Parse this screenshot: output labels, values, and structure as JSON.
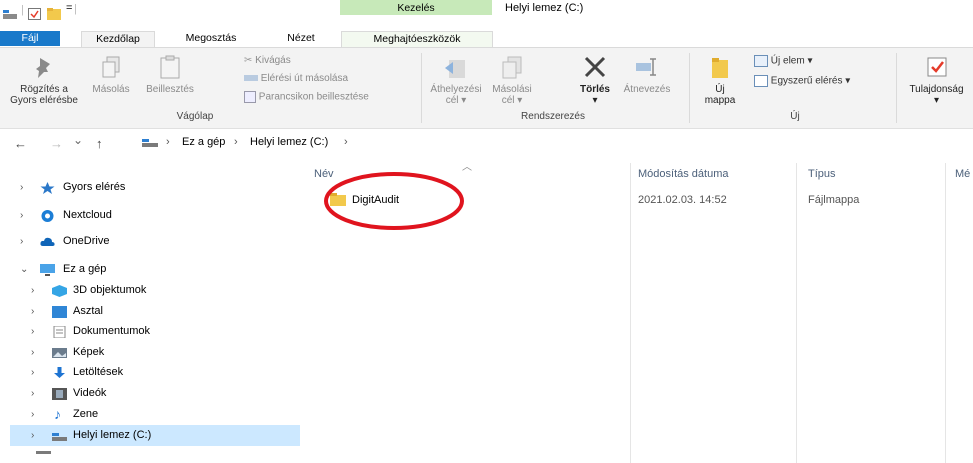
{
  "window": {
    "contextual_tab_group": "Kezelés",
    "title": "Helyi lemez (C:)"
  },
  "ribbon_tabs": [
    "Fájl",
    "Kezdőlap",
    "Megosztás",
    "Nézet",
    "Meghajtóeszközök"
  ],
  "ribbon": {
    "clipboard": {
      "pin_label_1": "Rögzítés a",
      "pin_label_2": "Gyors elérésbe",
      "copy": "Másolás",
      "paste": "Beillesztés",
      "cut": "Kivágás",
      "copy_path": "Elérési út másolása",
      "paste_shortcut": "Parancsikon beillesztése",
      "group": "Vágólap"
    },
    "organize": {
      "move_to_1": "Áthelyezési",
      "move_to_2": "cél ▾",
      "copy_to_1": "Másolási",
      "copy_to_2": "cél ▾",
      "delete": "Törlés",
      "delete_arrow": "▾",
      "rename": "Átnevezés",
      "group": "Rendszerezés"
    },
    "new": {
      "new_folder_1": "Új",
      "new_folder_2": "mappa",
      "new_item": "Új elem ▾",
      "easy_access": "Egyszerű elérés ▾",
      "group": "Új"
    },
    "open": {
      "properties": "Tulajdonság",
      "properties_arrow": "▾"
    }
  },
  "address": {
    "back": "←",
    "forward": "→",
    "recent": "⌄",
    "up": "↑",
    "crumbs": [
      "Ez a gép",
      "Helyi lemez (C:)"
    ],
    "separator": "›"
  },
  "columns": {
    "name": "Név",
    "modified": "Módosítás dátuma",
    "type": "Típus",
    "size": "Mé"
  },
  "nav_pane": {
    "quick_access": "Gyors elérés",
    "nextcloud": "Nextcloud",
    "onedrive": "OneDrive",
    "this_pc": "Ez a gép",
    "children": [
      "3D objektumok",
      "Asztal",
      "Dokumentumok",
      "Képek",
      "Letöltések",
      "Videók",
      "Zene",
      "Helyi lemez (C:)"
    ]
  },
  "files": [
    {
      "name": "DigitAudit",
      "modified": "2021.02.03. 14:52",
      "type": "Fájlmappa"
    }
  ],
  "colors": {
    "accent": "#1979ca",
    "selection": "#cce8ff",
    "contextual": "#c7e9b9",
    "annotation": "#e0141e"
  }
}
